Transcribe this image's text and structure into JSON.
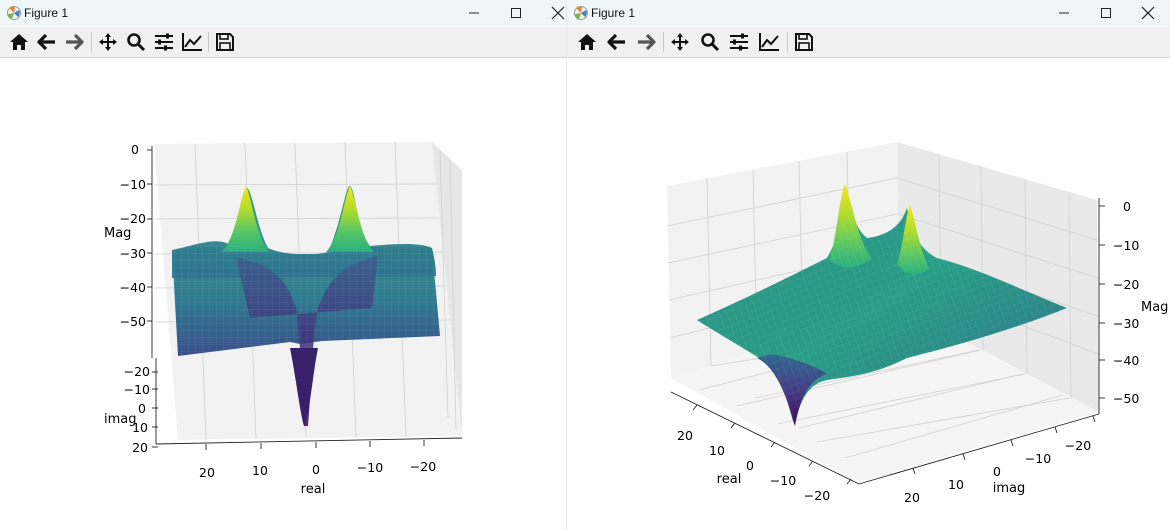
{
  "windows": [
    {
      "title": "Figure 1",
      "toolbar": [
        "home-icon",
        "back-arrow-icon",
        "forward-arrow-icon",
        "pan-icon",
        "zoom-icon",
        "configure-subplots-icon",
        "edit-axis-icon",
        "save-icon"
      ],
      "plot": {
        "zlabel": "Mag",
        "xlabel": "real",
        "ylabel": "imag",
        "z_ticks": [
          "0",
          "−10",
          "−20",
          "−30",
          "−40",
          "−50"
        ],
        "imag_ticks": [
          "−20",
          "−10",
          "0",
          "10",
          "20"
        ],
        "real_ticks": [
          "20",
          "10",
          "0",
          "−10",
          "−20"
        ]
      }
    },
    {
      "title": "Figure 1",
      "toolbar": [
        "home-icon",
        "back-arrow-icon",
        "forward-arrow-icon",
        "pan-icon",
        "zoom-icon",
        "configure-subplots-icon",
        "edit-axis-icon",
        "save-icon"
      ],
      "plot": {
        "zlabel": "Mag",
        "xlabel": "real",
        "ylabel": "imag",
        "z_ticks": [
          "0",
          "−10",
          "−20",
          "−30",
          "−40",
          "−50"
        ],
        "real_ticks": [
          "20",
          "10",
          "0",
          "−10",
          "−20"
        ],
        "imag_ticks": [
          "20",
          "10",
          "0",
          "−10",
          "−20"
        ]
      }
    }
  ],
  "chart_data": [
    {
      "type": "surface",
      "title": "",
      "xlabel": "real",
      "ylabel": "imag",
      "zlabel": "Mag",
      "xlim": [
        -25,
        25
      ],
      "ylim": [
        -25,
        25
      ],
      "zlim": [
        -55,
        0
      ],
      "colormap": "viridis",
      "features": {
        "peaks_at": [
          [
            0,
            -10
          ],
          [
            0,
            10
          ]
        ],
        "dip_at": [
          [
            0,
            0
          ]
        ]
      }
    },
    {
      "type": "surface",
      "title": "",
      "xlabel": "real",
      "ylabel": "imag",
      "zlabel": "Mag",
      "xlim": [
        -25,
        25
      ],
      "ylim": [
        -25,
        25
      ],
      "zlim": [
        -55,
        0
      ],
      "colormap": "viridis",
      "features": {
        "peaks_at": [
          [
            0,
            -10
          ],
          [
            0,
            10
          ]
        ],
        "dip_at": [
          [
            0,
            0
          ]
        ]
      }
    }
  ]
}
